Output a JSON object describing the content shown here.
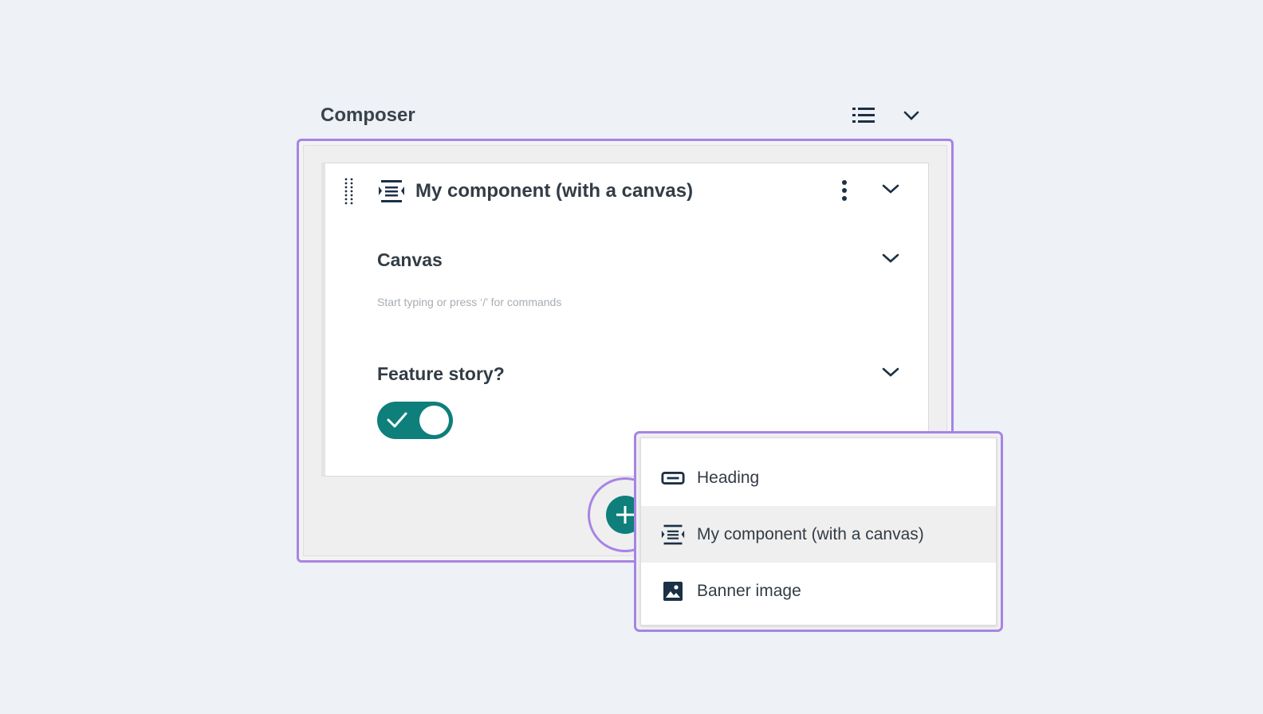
{
  "header": {
    "title": "Composer",
    "list_icon": "list-icon",
    "collapse_icon": "chevron-down-icon"
  },
  "component": {
    "title": "My component (with a canvas)",
    "drag_icon": "drag-handle-icon",
    "type_icon": "component-canvas-icon",
    "more_icon": "more-vertical-icon",
    "collapse_icon": "chevron-down-icon"
  },
  "canvas_section": {
    "title": "Canvas",
    "placeholder": "Start typing or press ‘/’ for commands"
  },
  "feature_section": {
    "title": "Feature story?",
    "toggle_on": true
  },
  "add_button": {
    "icon": "plus-icon"
  },
  "menu": {
    "items": [
      {
        "label": "Heading",
        "icon": "heading-icon",
        "highlighted": false
      },
      {
        "label": "My component (with a canvas)",
        "icon": "component-canvas-icon",
        "highlighted": true
      },
      {
        "label": "Banner image",
        "icon": "image-icon",
        "highlighted": false
      }
    ]
  },
  "colors": {
    "accent": "#0e7f7a",
    "highlight_border": "#a684e6",
    "icon": "#1c3046"
  }
}
